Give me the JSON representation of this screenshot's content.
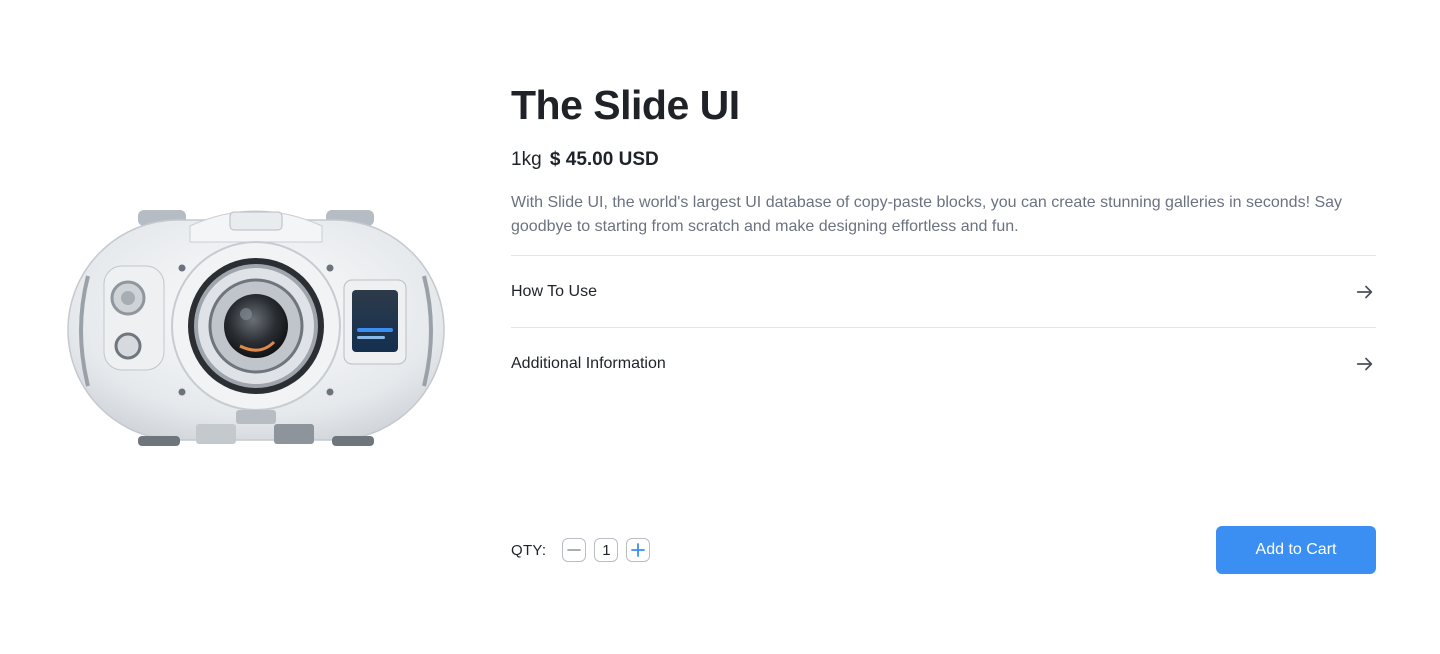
{
  "product": {
    "title": "The Slide UI",
    "weight": "1kg",
    "price": "$ 45.00 USD",
    "description": "With Slide UI, the world's largest UI database of copy-paste blocks, you can create stunning galleries in seconds! Say goodbye to starting from scratch and make designing effortless and fun.",
    "image_icon": "camera-device-image"
  },
  "accordion": {
    "items": [
      {
        "label": "How To Use",
        "icon": "arrow-right-icon"
      },
      {
        "label": "Additional Information",
        "icon": "arrow-right-icon"
      }
    ]
  },
  "cart": {
    "qty_label": "QTY:",
    "quantity": "1",
    "decrement_icon": "minus-icon",
    "increment_icon": "plus-icon",
    "add_label": "Add to Cart",
    "accent_color": "#3b8ff3"
  }
}
